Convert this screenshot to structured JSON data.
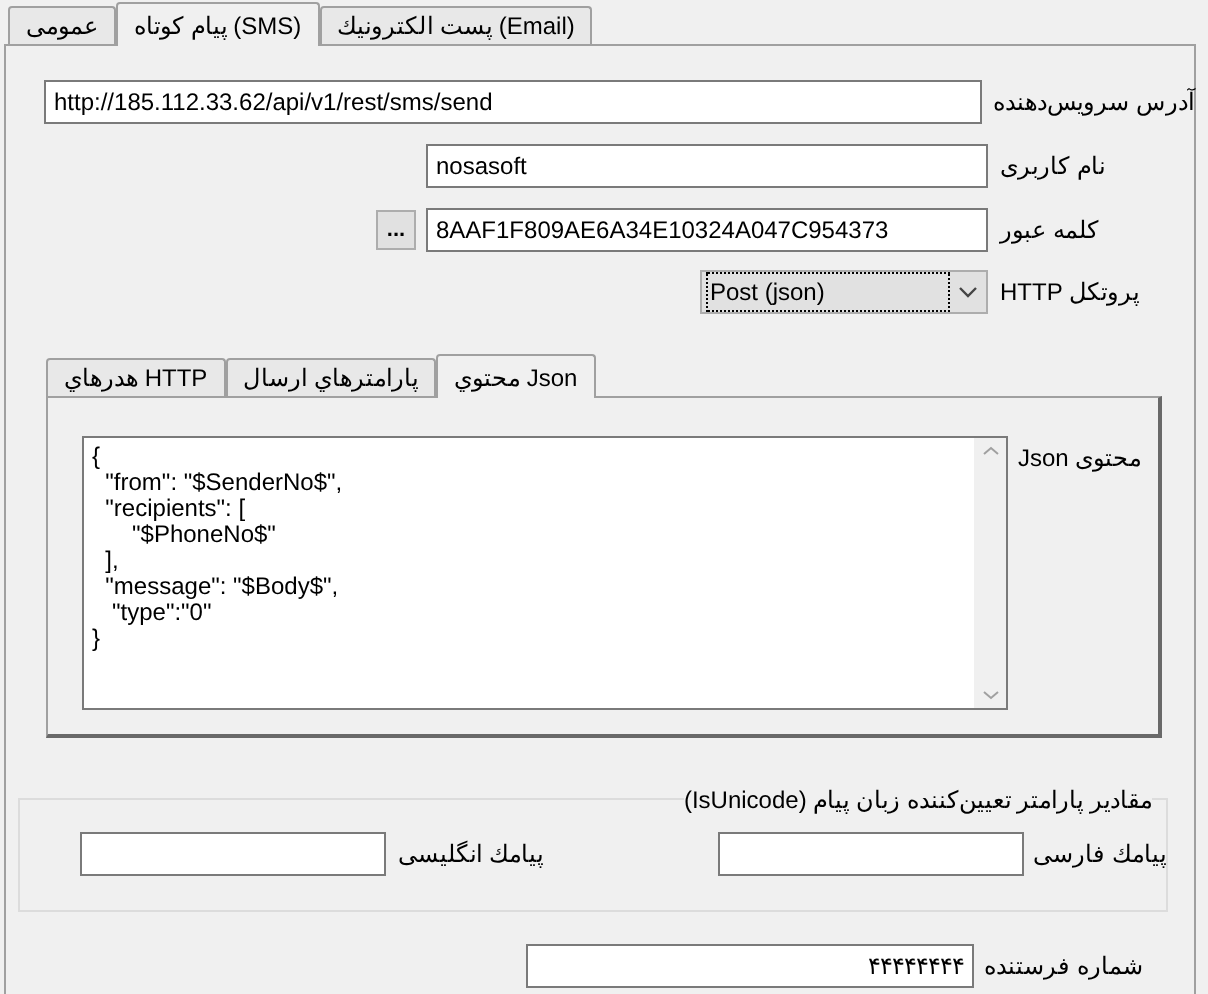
{
  "tabs": [
    {
      "label": "پست الکترونیك (Email)",
      "selected": false
    },
    {
      "label": "پیام کوتاه (SMS)",
      "selected": true
    },
    {
      "label": "عمومی",
      "selected": false
    }
  ],
  "service_address": {
    "label": "آدرس سرویس‌دهنده",
    "value": "http://185.112.33.62/api/v1/rest/sms/send"
  },
  "username": {
    "label": "نام کاربری",
    "value": "nosasoft"
  },
  "password": {
    "label": "کلمه عبور",
    "value": "8AAF1F809AE6A34E10324A047C954373",
    "button": "..."
  },
  "http_protocol": {
    "label": "پروتکل HTTP",
    "value": "Post (json)"
  },
  "inner_tabs": [
    {
      "label": "محتوي Json",
      "selected": true
    },
    {
      "label": "پارامترهاي ارسال",
      "selected": false
    },
    {
      "label": "هدرهاي HTTP",
      "selected": false
    }
  ],
  "json_content": {
    "label": "محتوی Json",
    "value": "{\n  \"from\": \"$SenderNo$\",\n  \"recipients\": [\n      \"$PhoneNo$\"\n  ],\n  \"message\": \"$Body$\",\n   \"type\":\"0\"\n}"
  },
  "unicode_group": {
    "title": "مقادیر پارامتر تعیین‌کننده زبان پیام (IsUnicode)",
    "persian": {
      "label": "پیامك فارسی"
    },
    "english": {
      "label": "پیامك انگلیسی"
    }
  },
  "sender_number": {
    "label": "شماره فرستنده",
    "value": "۴۴۴۴۴۴۴۴"
  }
}
